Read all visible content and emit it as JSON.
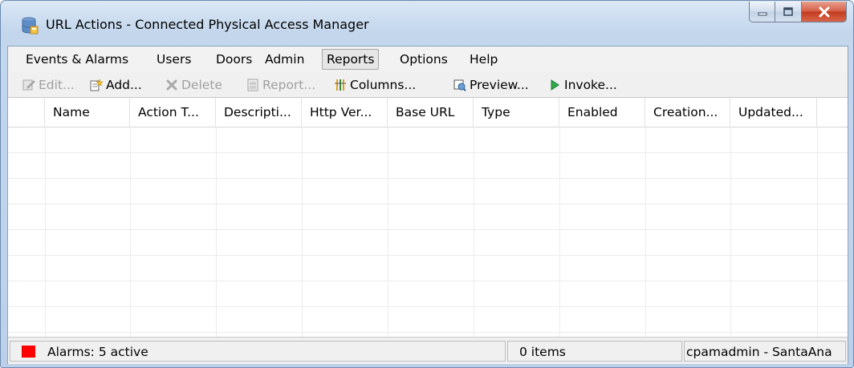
{
  "window": {
    "title": "URL Actions - Connected Physical Access Manager",
    "app_icon": "database-icon",
    "controls": [
      "minimize-icon",
      "maximize-icon",
      "close-icon"
    ]
  },
  "menubar": {
    "items": [
      {
        "label": "Events & Alarms",
        "active": false
      },
      {
        "label": "Users",
        "active": false
      },
      {
        "label": "Doors",
        "active": false
      },
      {
        "label": "Admin",
        "active": false
      },
      {
        "label": "Reports",
        "active": true
      },
      {
        "label": "Options",
        "active": false
      },
      {
        "label": "Help",
        "active": false
      }
    ]
  },
  "toolbar": {
    "items": [
      {
        "label": "Edit...",
        "icon": "edit-icon",
        "enabled": false
      },
      {
        "label": "Add...",
        "icon": "add-icon",
        "enabled": true
      },
      {
        "label": "Delete",
        "icon": "delete-icon",
        "enabled": false
      },
      {
        "label": "Report...",
        "icon": "report-icon",
        "enabled": false
      },
      {
        "label": "Columns...",
        "icon": "columns-icon",
        "enabled": true
      },
      {
        "label": "Preview...",
        "icon": "preview-icon",
        "enabled": true
      },
      {
        "label": "Invoke...",
        "icon": "invoke-icon",
        "enabled": true
      }
    ]
  },
  "table": {
    "columns": [
      "",
      "Name",
      "Action T...",
      "Descripti...",
      "Http Ver...",
      "Base URL",
      "Type",
      "Enabled",
      "Creation...",
      "Updated...",
      ""
    ],
    "rows": []
  },
  "statusbar": {
    "alarms": "Alarms: 5 active",
    "alarm_color": "#ff0000",
    "item_count": "0 items",
    "user": "cpamadmin - SantaAna"
  }
}
